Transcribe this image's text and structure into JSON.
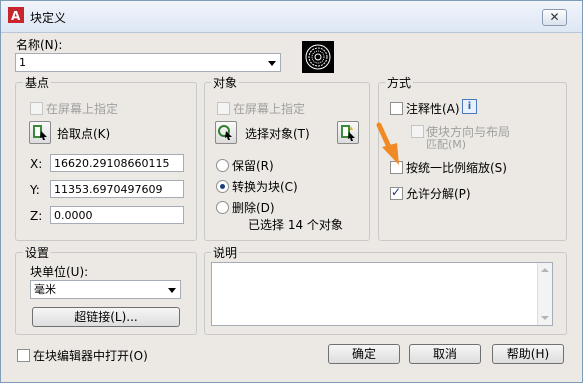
{
  "window": {
    "title": "块定义",
    "close_symbol": "✕"
  },
  "name": {
    "label": "名称(N):",
    "value": "1"
  },
  "basepoint": {
    "title": "基点",
    "onscreen_label": "在屏幕上指定",
    "pick_label": "拾取点(K)",
    "x_label": "X:",
    "x_value": "16620.29108660115",
    "y_label": "Y:",
    "y_value": "11353.6970497609",
    "z_label": "Z:",
    "z_value": "0.0000"
  },
  "objects": {
    "title": "对象",
    "onscreen_label": "在屏幕上指定",
    "select_label": "选择对象(T)",
    "retain_label": "保留(R)",
    "convert_label": "转换为块(C)",
    "delete_label": "删除(D)",
    "selected_count_text": "已选择 14 个对象"
  },
  "behavior": {
    "title": "方式",
    "annotative_label": "注释性(A)",
    "info_symbol": "i",
    "match_orientation_line1": "使块方向与布局",
    "match_orientation_line2": "匹配(M)",
    "scale_uniformly_label": "按统一比例缩放(S)",
    "allow_explode_label": "允许分解(P)"
  },
  "settings": {
    "title": "设置",
    "unit_label": "块单位(U):",
    "unit_value": "毫米",
    "hyperlink_label": "超链接(L)..."
  },
  "description": {
    "title": "说明",
    "value": ""
  },
  "footer": {
    "open_in_editor_label": "在块编辑器中打开(O)",
    "ok_label": "确定",
    "cancel_label": "取消",
    "help_label": "帮助(H)"
  },
  "colors": {
    "arrow": "#f08a24",
    "titlebar": "#dde6f3",
    "dialog_bg": "#ece9e4"
  }
}
